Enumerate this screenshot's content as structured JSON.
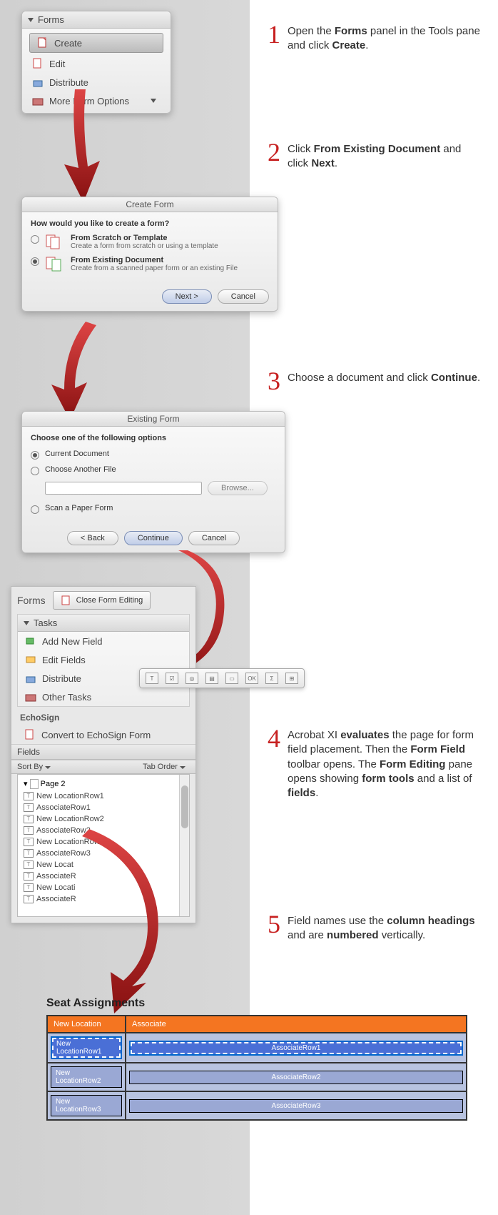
{
  "forms_panel": {
    "title": "Forms",
    "items": [
      "Create",
      "Edit",
      "Distribute",
      "More Form Options"
    ]
  },
  "step1": {
    "num": "1",
    "p1": "Open the ",
    "b1": "Forms",
    "p2": " panel in the Tools pane and click ",
    "b2": "Create",
    "p3": "."
  },
  "step2": {
    "num": "2",
    "p1": "Click ",
    "b1": "From Existing Document",
    "p2": " and click ",
    "b2": "Next",
    "p3": "."
  },
  "dlg1": {
    "title": "Create Form",
    "prompt": "How would you like to create a form?",
    "opt1_t": "From Scratch or Template",
    "opt1_d": "Create a form from scratch or using a template",
    "opt2_t": "From Existing Document",
    "opt2_d": "Create from a scanned paper form or an existing File",
    "next": "Next >",
    "cancel": "Cancel"
  },
  "step3": {
    "num": "3",
    "p1": "Choose a document and click ",
    "b1": "Continue",
    "p2": "."
  },
  "dlg2": {
    "title": "Existing Form",
    "prompt": "Choose one of the following options",
    "opt1": "Current Document",
    "opt2": "Choose Another File",
    "opt3": "Scan a Paper Form",
    "browse": "Browse...",
    "back": "< Back",
    "continue": "Continue",
    "cancel": "Cancel"
  },
  "forms_tab": {
    "label": "Forms",
    "close": "Close Form Editing",
    "tasks_hdr": "Tasks",
    "tasks": [
      "Add New Field",
      "Edit Fields",
      "Distribute",
      "Other Tasks"
    ],
    "echo_hdr": "EchoSign",
    "echo": "Convert to EchoSign Form",
    "fields_hdr": "Fields",
    "sort": "Sort By",
    "taborder": "Tab Order",
    "page": "Page 2",
    "fields": [
      "New LocationRow1",
      "AssociateRow1",
      "New LocationRow2",
      "AssociateRow2",
      "New LocationRow3",
      "AssociateRow3",
      "New Locat",
      "AssociateR",
      "New Locati",
      "AssociateR"
    ]
  },
  "toolbar": {
    "items": [
      "T",
      "☑",
      "◎",
      "▤",
      "▭",
      "OK",
      "Σ",
      "⊞"
    ]
  },
  "step4": {
    "num": "4",
    "p1": "Acrobat XI ",
    "b1": "evaluates",
    "p2": " the page for form field placement. Then the ",
    "b2": "Form Field",
    "p3": " toolbar opens. The ",
    "b3": "Form Editing",
    "p4": " pane opens showing ",
    "b4": "form tools",
    "p5": " and a list of ",
    "b5": "fields",
    "p6": "."
  },
  "step5": {
    "num": "5",
    "p1": "Field names use the ",
    "b1": "column headings",
    "p2": " and are ",
    "b2": "numbered",
    "p3": " vertically."
  },
  "seat": {
    "title": "Seat Assignments",
    "col1": "New Location",
    "col2": "Associate",
    "rows": [
      {
        "a": "New LocationRow1",
        "b": "AssociateRow1"
      },
      {
        "a": "New LocationRow2",
        "b": "AssociateRow2"
      },
      {
        "a": "New LocationRow3",
        "b": "AssociateRow3"
      }
    ]
  }
}
